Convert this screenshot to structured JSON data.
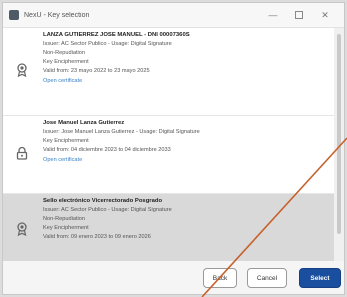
{
  "window": {
    "title": "NexU - Key selection",
    "minimize_glyph": "—",
    "close_glyph": "✕"
  },
  "certificates": [
    {
      "name": "LANZA GUTIERREZ JOSE MANUEL - DNI 00007360S",
      "lines": [
        "Issuer: AC Sector Publico - Usage: Digital Signature",
        "Non-Repudiation",
        "Key Encipherment",
        "Valid from: 23 mayo 2022 to 23 mayo 2025"
      ],
      "link": "Open certificate",
      "icon": "certificate-badge-icon"
    },
    {
      "name": "Jose Manuel Lanza Gutierrez",
      "lines": [
        "Issuer: Jose Manuel Lanza Gutierrez - Usage: Digital Signature",
        "Key Encipherment",
        "Valid from: 04 diciembre 2023 to 04 diciembre 2033"
      ],
      "link": "Open certificate",
      "icon": "lock-icon"
    },
    {
      "name": "Sello electrónico Vicerrectorado Posgrado",
      "lines": [
        "Issuer: AC Sector Publico - Usage: Digital Signature",
        "Non-Repudiation",
        "Key Encipherment",
        "Valid from: 09 enero 2023 to 09 enero 2026"
      ],
      "link": "",
      "icon": "certificate-badge-icon"
    }
  ],
  "buttons": {
    "back": "Back",
    "cancel": "Cancel",
    "select": "Select"
  },
  "colors": {
    "accent": "#1a4fa0",
    "link": "#3b82c4",
    "selected_row": "#d9d9d9",
    "annotation_line": "#c8602a"
  }
}
